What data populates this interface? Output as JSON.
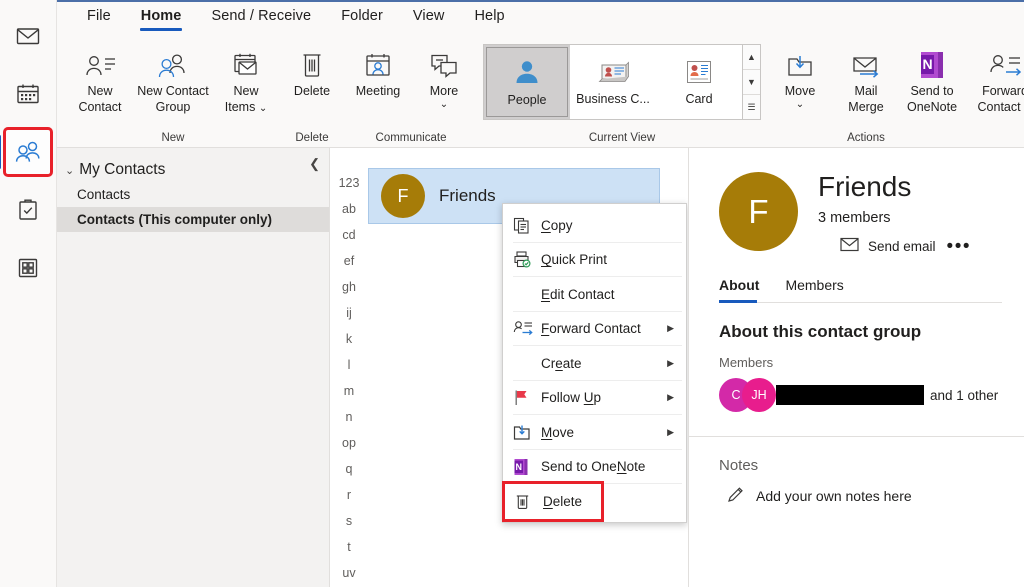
{
  "nav_rail": {
    "items": [
      {
        "name": "mail",
        "icon": "mail-icon",
        "selected": false
      },
      {
        "name": "calendar",
        "icon": "calendar-icon",
        "selected": false
      },
      {
        "name": "people",
        "icon": "people-icon",
        "selected": true
      },
      {
        "name": "tasks",
        "icon": "tasks-clipboard-icon",
        "selected": false
      },
      {
        "name": "more-apps",
        "icon": "apps-grid-icon",
        "selected": false
      }
    ]
  },
  "ribbon": {
    "tabs": [
      {
        "label": "File",
        "active": false
      },
      {
        "label": "Home",
        "active": true
      },
      {
        "label": "Send / Receive",
        "active": false
      },
      {
        "label": "Folder",
        "active": false
      },
      {
        "label": "View",
        "active": false
      },
      {
        "label": "Help",
        "active": false
      }
    ],
    "groups": [
      {
        "label": "New",
        "buttons": [
          {
            "label_line1": "New",
            "label_line2": "Contact",
            "icon": "new-contact-icon"
          },
          {
            "label_line1": "New Contact",
            "label_line2": "Group",
            "icon": "new-contact-group-icon"
          },
          {
            "label_line1": "New",
            "label_line2": "Items",
            "icon": "new-items-icon",
            "dropdown": true
          }
        ]
      },
      {
        "label": "Delete",
        "buttons": [
          {
            "label_line1": "Delete",
            "label_line2": "",
            "icon": "trash-icon"
          }
        ]
      },
      {
        "label": "Communicate",
        "buttons": [
          {
            "label_line1": "Meeting",
            "label_line2": "",
            "icon": "meeting-icon"
          },
          {
            "label_line1": "More",
            "label_line2": "",
            "icon": "more-communicate-icon",
            "dropdown": true
          }
        ]
      },
      {
        "label": "Current View",
        "gallery": [
          {
            "label": "People",
            "icon": "people-view-icon",
            "selected": true
          },
          {
            "label": "Business C...",
            "icon": "business-card-view-icon",
            "selected": false
          },
          {
            "label": "Card",
            "icon": "card-view-icon",
            "selected": false
          }
        ],
        "scroll_buttons": [
          {
            "name": "gallery-scroll-up",
            "glyph": "▲"
          },
          {
            "name": "gallery-scroll-down",
            "glyph": "▼"
          },
          {
            "name": "gallery-expand",
            "glyph": "☰"
          }
        ]
      },
      {
        "label": "Actions",
        "buttons": [
          {
            "label_line1": "Move",
            "label_line2": "",
            "icon": "move-icon",
            "dropdown": true
          },
          {
            "label_line1": "Mail",
            "label_line2": "Merge",
            "icon": "mail-merge-icon"
          },
          {
            "label_line1": "Send to",
            "label_line2": "OneNote",
            "icon": "onenote-icon"
          }
        ]
      },
      {
        "label": "",
        "buttons": [
          {
            "label_line1": "Forward",
            "label_line2": "Contact",
            "icon": "forward-contact-icon",
            "dropdown": true
          }
        ]
      }
    ]
  },
  "folder_pane": {
    "collapse_icon": "chevron-left-icon",
    "header": "My Contacts",
    "header_chevron": "chevron-down-icon",
    "items": [
      {
        "label": "Contacts",
        "selected": false
      },
      {
        "label": "Contacts (This computer only)",
        "selected": true
      }
    ]
  },
  "alpha_index": [
    "123",
    "ab",
    "cd",
    "ef",
    "gh",
    "ij",
    "k",
    "l",
    "m",
    "n",
    "op",
    "q",
    "r",
    "s",
    "t",
    "uv"
  ],
  "contact_list": {
    "rows": [
      {
        "initial": "F",
        "name": "Friends",
        "avatar_color": "#A67C08",
        "selected": true
      }
    ]
  },
  "context_menu": {
    "items": [
      {
        "label": "Copy",
        "accel": "C",
        "icon": "copy-icon",
        "submenu": false,
        "highlighted": false
      },
      {
        "label": "Quick Print",
        "accel": "Q",
        "icon": "quick-print-icon",
        "submenu": false,
        "highlighted": false
      },
      {
        "label": "Edit Contact",
        "accel": "E",
        "icon": "",
        "submenu": false,
        "highlighted": false
      },
      {
        "label": "Forward Contact",
        "accel": "F",
        "icon": "forward-contact-icon",
        "submenu": true,
        "highlighted": false
      },
      {
        "label": "Create",
        "accel": "e",
        "icon": "",
        "submenu": true,
        "highlighted": false
      },
      {
        "label": "Follow Up",
        "accel": "U",
        "icon": "flag-icon",
        "submenu": true,
        "highlighted": false
      },
      {
        "label": "Move",
        "accel": "M",
        "icon": "move-icon",
        "submenu": true,
        "highlighted": false
      },
      {
        "label": "Send to OneNote",
        "accel": "N",
        "icon": "onenote-icon",
        "submenu": false,
        "highlighted": false
      },
      {
        "label": "Delete",
        "accel": "D",
        "icon": "trash-icon",
        "submenu": false,
        "highlighted": true
      }
    ]
  },
  "reading_pane": {
    "avatar_initial": "F",
    "avatar_color": "#A67C08",
    "title": "Friends",
    "member_count": "3 members",
    "send_email_label": "Send email",
    "send_email_icon": "envelope-icon",
    "more_glyph": "•••",
    "tabs": [
      {
        "label": "About",
        "active": true
      },
      {
        "label": "Members",
        "active": false
      }
    ],
    "about_heading": "About this contact group",
    "members_label": "Members",
    "members_avatars": [
      {
        "initial": "C",
        "color": "#D329A8"
      },
      {
        "initial": "JH",
        "color": "#E81D8D"
      }
    ],
    "members_redacted": true,
    "members_suffix": "and 1 other",
    "notes_label": "Notes",
    "notes_placeholder": "Add your own notes here",
    "notes_icon": "pencil-icon"
  },
  "colors": {
    "accent_blue": "#185abd",
    "highlight_red": "#e8212a",
    "selection_blue": "#cde1f5",
    "ribbon_bg": "#faf9f8",
    "folder_bg": "#f3f2f1"
  }
}
